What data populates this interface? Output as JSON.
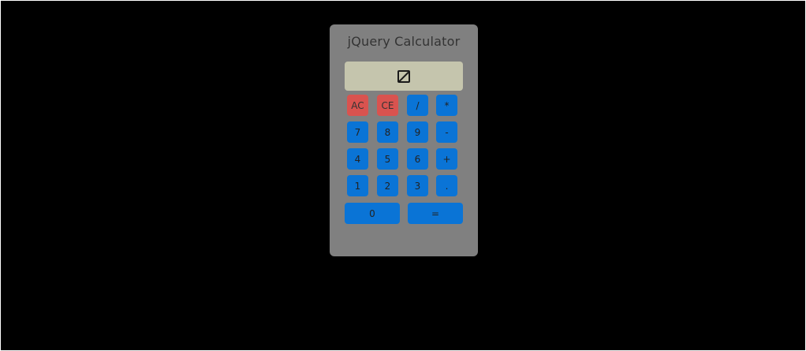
{
  "calculator": {
    "title": "jQuery Calculator",
    "display": "0",
    "keys": {
      "ac": "AC",
      "ce": "CE",
      "divide": "/",
      "multiply": "*",
      "seven": "7",
      "eight": "8",
      "nine": "9",
      "minus": "-",
      "four": "4",
      "five": "5",
      "six": "6",
      "plus": "+",
      "one": "1",
      "two": "2",
      "three": "3",
      "decimal": ".",
      "zero": "0",
      "equals": "="
    },
    "colors": {
      "body": "#808080",
      "display": "#c5c5ad",
      "digit_key": "#0a74d6",
      "clear_key": "#d9534f",
      "background": "#000000"
    }
  }
}
